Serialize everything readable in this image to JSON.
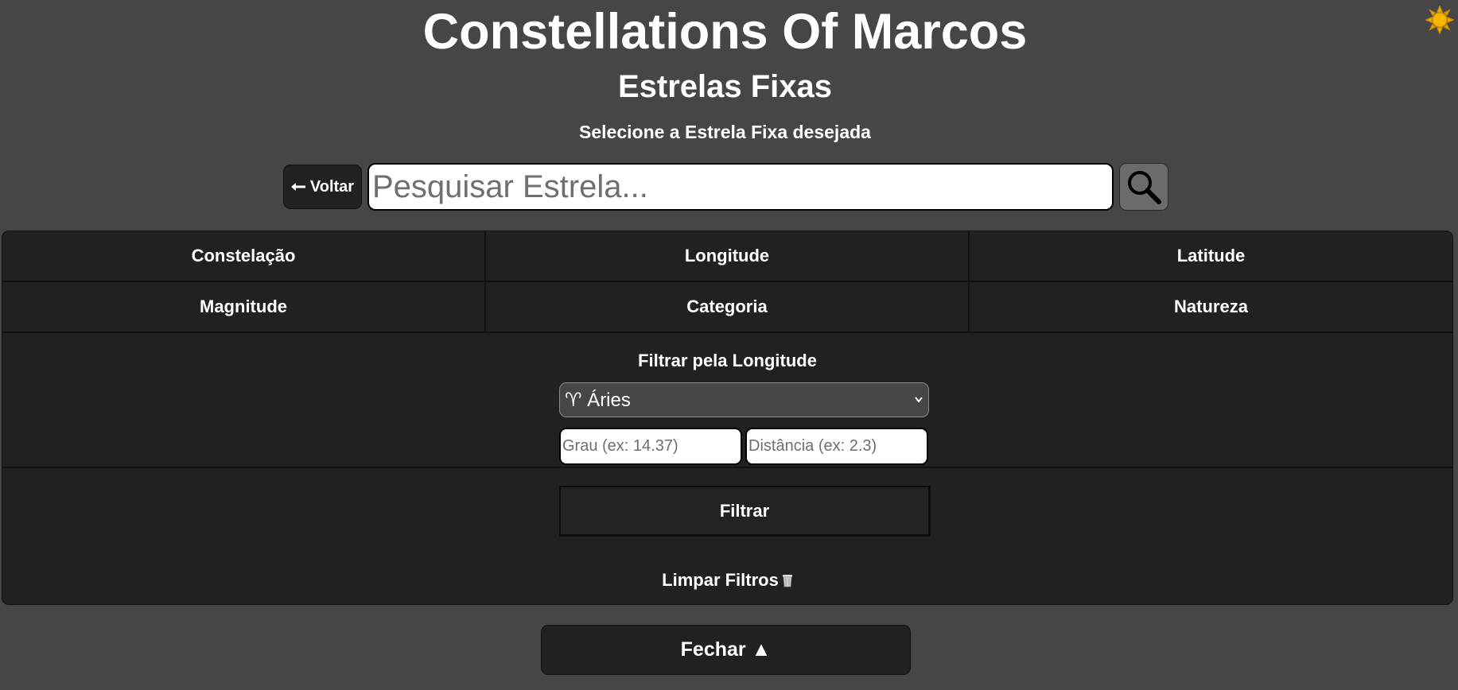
{
  "header": {
    "title": "Constellations Of Marcos",
    "subtitle": "Estrelas Fixas",
    "instruction": "Selecione a Estrela Fixa desejada"
  },
  "theme_toggle": {
    "icon": "sun-icon",
    "color": "#f5b800"
  },
  "search": {
    "back_label": "Voltar",
    "back_icon": "arrow-left-icon",
    "placeholder": "Pesquisar Estrela...",
    "value": "",
    "button_icon": "magnifier-icon"
  },
  "filter_tabs": [
    {
      "label": "Constelação"
    },
    {
      "label": "Longitude"
    },
    {
      "label": "Latitude"
    },
    {
      "label": "Magnitude"
    },
    {
      "label": "Categoria"
    },
    {
      "label": "Natureza"
    }
  ],
  "longitude_filter": {
    "label": "Filtrar pela Longitude",
    "selected_sign": "♈ Áries",
    "degree_placeholder": "Grau (ex: 14.37)",
    "distance_placeholder": "Distância (ex: 2.3)",
    "submit_label": "Filtrar"
  },
  "clear_filters": {
    "label": "Limpar Filtros",
    "icon": "trash-icon"
  },
  "close_label": "Fechar ▲"
}
